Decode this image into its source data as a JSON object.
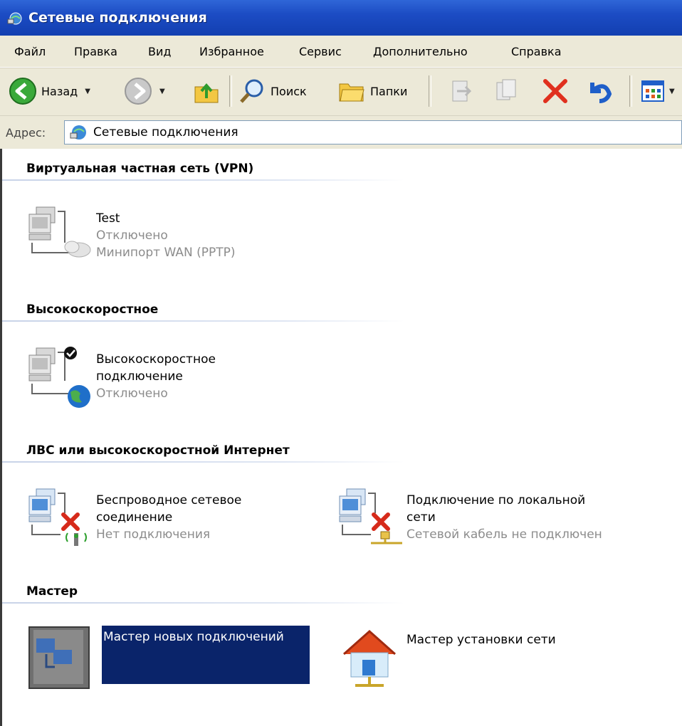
{
  "window": {
    "title": "Сетевые подключения"
  },
  "menu": [
    "Файл",
    "Правка",
    "Вид",
    "Избранное",
    "Сервис",
    "Дополнительно",
    "Справка"
  ],
  "toolbar": {
    "back": "Назад",
    "search": "Поиск",
    "folders": "Папки"
  },
  "address": {
    "label": "Адрес:",
    "value": "Сетевые подключения"
  },
  "groups": {
    "vpn": {
      "header": "Виртуальная частная сеть (VPN)",
      "items": [
        {
          "name": "Test",
          "status": "Отключено",
          "device": "Минипорт WAN (PPTP)"
        }
      ]
    },
    "broadband": {
      "header": "Высокоскоростное",
      "items": [
        {
          "name_line1": "Высокоскоростное",
          "name_line2": "подключение",
          "status": "Отключено"
        }
      ]
    },
    "lan": {
      "header": "ЛВС или высокоскоростной Интернет",
      "items": [
        {
          "name_line1": "Беспроводное сетевое",
          "name_line2": "соединение",
          "status": "Нет подключения"
        },
        {
          "name_line1": "Подключение по локальной",
          "name_line2": "сети",
          "status": "Сетевой кабель не подключен"
        }
      ]
    },
    "wizard": {
      "header": "Мастер",
      "items": [
        {
          "name": "Мастер новых подключений"
        },
        {
          "name": "Мастер установки сети"
        }
      ]
    }
  }
}
